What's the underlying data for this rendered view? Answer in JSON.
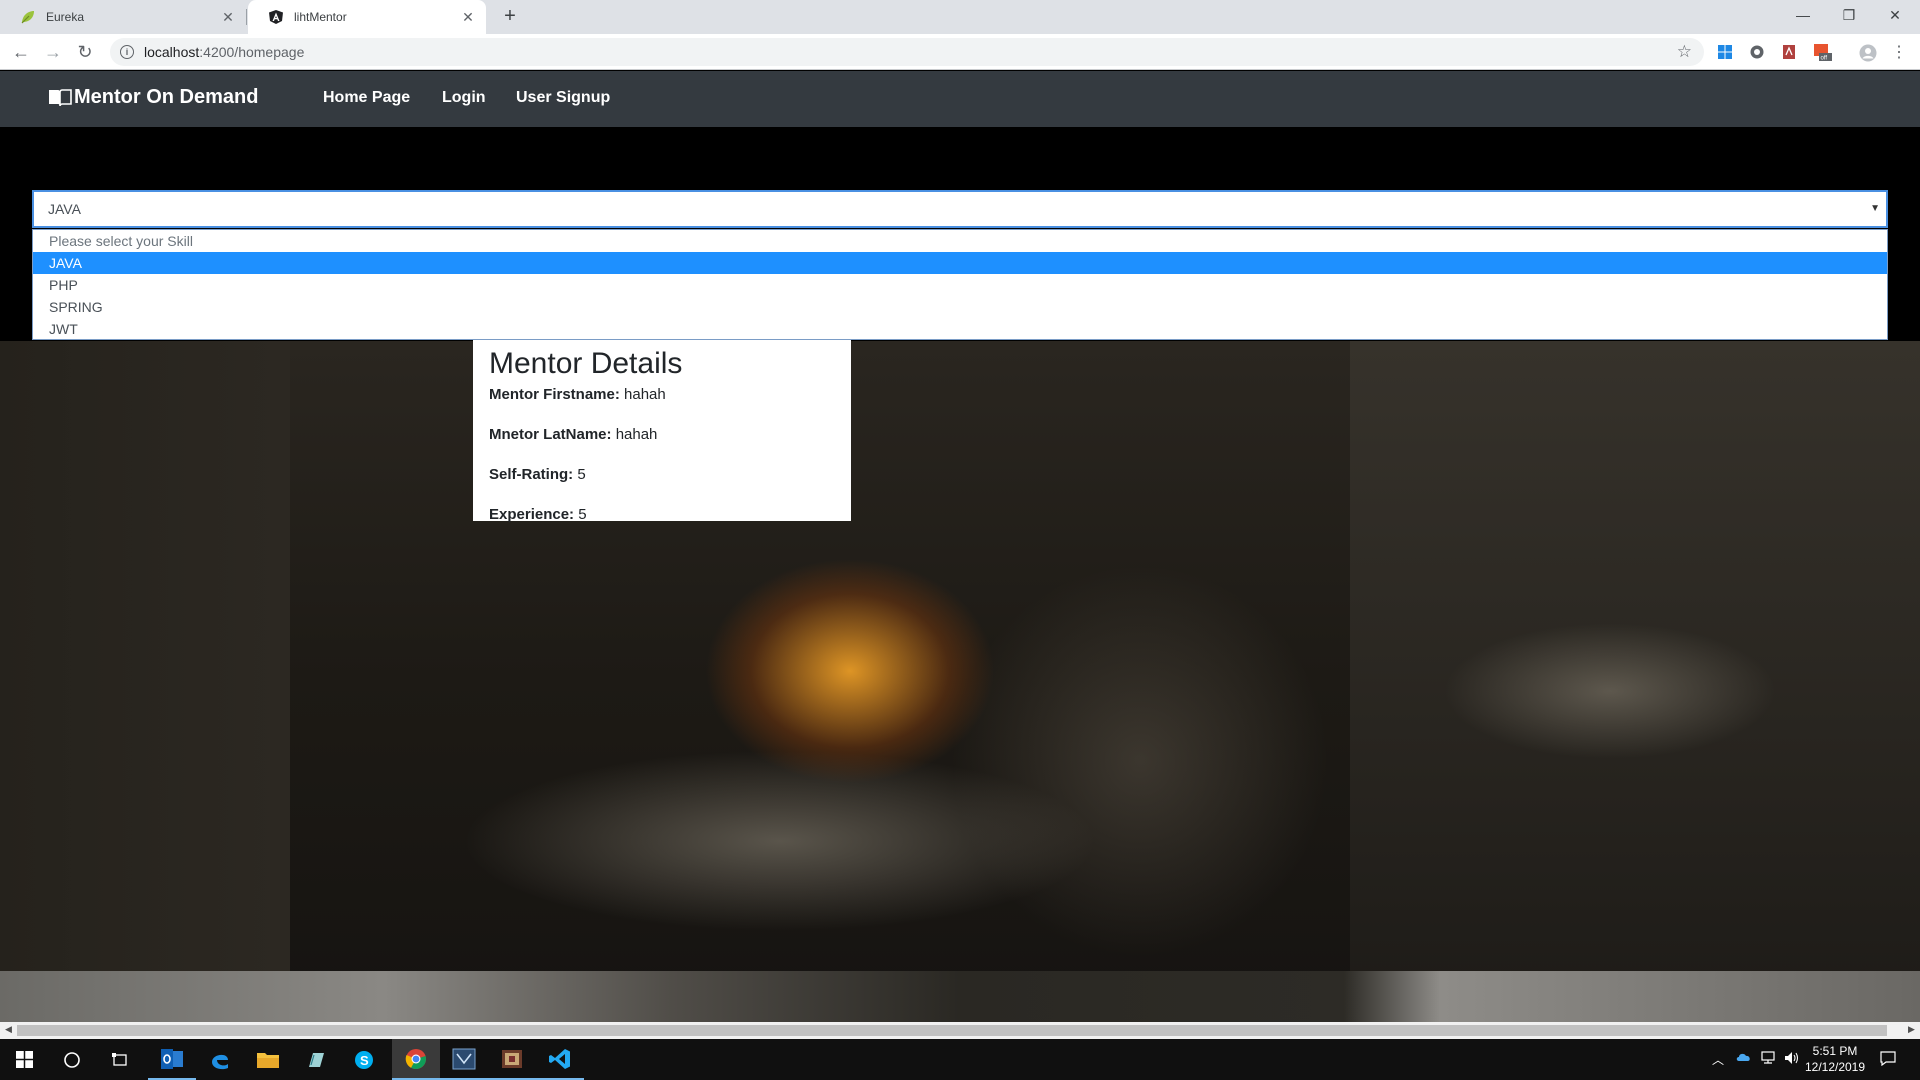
{
  "browser": {
    "tabs": [
      {
        "title": "Eureka",
        "icon": "leaf-icon"
      },
      {
        "title": "lihtMentor",
        "icon": "angular-icon"
      }
    ],
    "address": {
      "host": "localhost",
      "path": ":4200/homepage"
    }
  },
  "navbar": {
    "brand": "Mentor On Demand",
    "links": [
      "Home Page",
      "Login",
      "User Signup"
    ]
  },
  "skill_select": {
    "value": "JAVA",
    "options": [
      "Please select your Skill",
      "JAVA",
      "PHP",
      "SPRING",
      "JWT"
    ],
    "highlighted": "JAVA"
  },
  "mentor_details": {
    "heading": "Mentor Details",
    "rows": [
      {
        "label": "Mentor Firstname:",
        "value": "hahah"
      },
      {
        "label": "Mnetor LatName:",
        "value": "hahah"
      },
      {
        "label": "Self-Rating:",
        "value": "5"
      },
      {
        "label": "Experience:",
        "value": "5"
      }
    ]
  },
  "taskbar": {
    "clock": {
      "time": "5:51 PM",
      "date": "12/12/2019"
    }
  },
  "colors": {
    "navbar": "#343a40",
    "accent": "#1e90ff",
    "taskbar": "#101010"
  }
}
